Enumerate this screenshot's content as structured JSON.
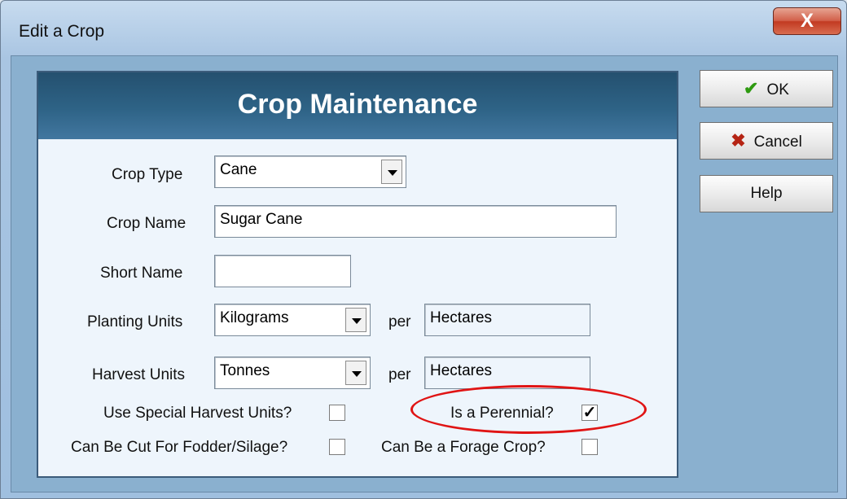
{
  "window": {
    "title": "Edit a Crop",
    "close_glyph": "X"
  },
  "panel": {
    "header": "Crop Maintenance"
  },
  "form": {
    "crop_type": {
      "label": "Crop Type",
      "value": "Cane"
    },
    "crop_name": {
      "label": "Crop Name",
      "value": "Sugar Cane"
    },
    "short_name": {
      "label": "Short Name",
      "value": ""
    },
    "planting_units": {
      "label": "Planting Units",
      "value": "Kilograms",
      "per_label": "per",
      "per_value": "Hectares"
    },
    "harvest_units": {
      "label": "Harvest Units",
      "value": "Tonnes",
      "per_label": "per",
      "per_value": "Hectares"
    },
    "special_harvest": {
      "label": "Use Special Harvest Units?",
      "checked": false
    },
    "perennial": {
      "label": "Is a Perennial?",
      "checked": true
    },
    "fodder": {
      "label": "Can Be Cut For Fodder/Silage?",
      "checked": false
    },
    "forage": {
      "label": "Can Be a Forage Crop?",
      "checked": false
    }
  },
  "buttons": {
    "ok": "OK",
    "cancel": "Cancel",
    "help": "Help"
  },
  "icons": {
    "ok": "checkmark-icon",
    "cancel": "x-icon"
  },
  "colors": {
    "header": "#2e6386",
    "highlight": "#e01414"
  }
}
